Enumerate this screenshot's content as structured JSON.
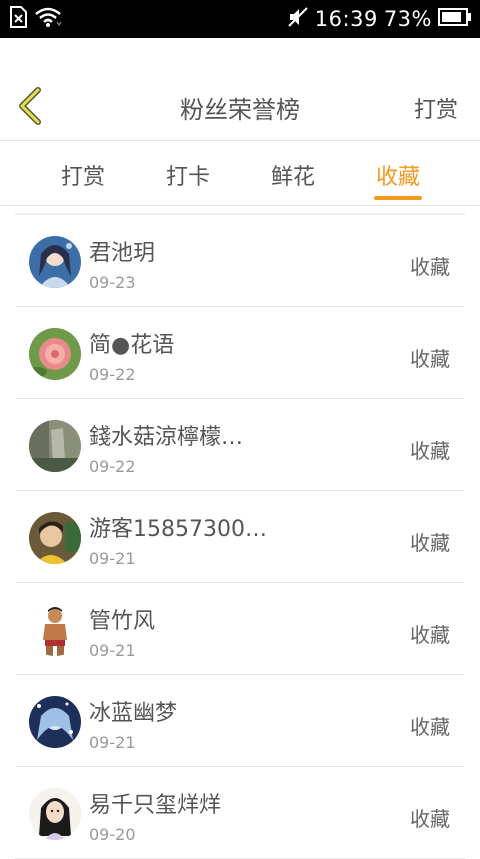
{
  "status_bar": {
    "time": "16:39",
    "battery": "73%",
    "icons": [
      "sim-absent-icon",
      "wifi-icon",
      "mute-icon",
      "battery-icon"
    ]
  },
  "header": {
    "title": "粉丝荣誉榜",
    "action_label": "打赏",
    "back_icon": "chevron-left-icon"
  },
  "tabs": [
    {
      "label": "打赏",
      "active": false
    },
    {
      "label": "打卡",
      "active": false
    },
    {
      "label": "鲜花",
      "active": false
    },
    {
      "label": "收藏",
      "active": true
    }
  ],
  "accent_color": "#f19a1d",
  "fans": [
    {
      "name": "君池玥",
      "date": "09-23",
      "action": "收藏"
    },
    {
      "name": "简●花语",
      "date": "09-22",
      "action": "收藏"
    },
    {
      "name": "錢水菇涼檸檬…",
      "date": "09-22",
      "action": "收藏"
    },
    {
      "name": "游客15857300…",
      "date": "09-21",
      "action": "收藏"
    },
    {
      "name": "管竹风",
      "date": "09-21",
      "action": "收藏"
    },
    {
      "name": "冰蓝幽梦",
      "date": "09-21",
      "action": "收藏"
    },
    {
      "name": "易千只玺烊烊",
      "date": "09-20",
      "action": "收藏"
    }
  ]
}
